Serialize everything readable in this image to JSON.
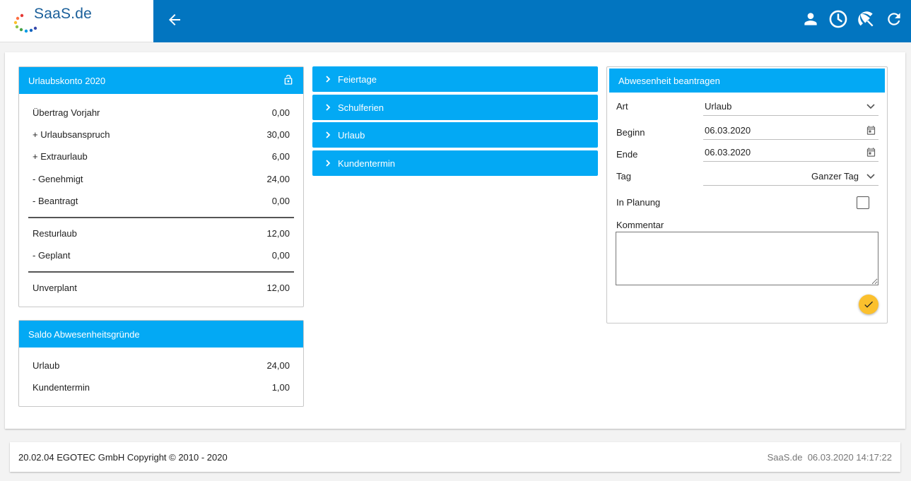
{
  "header": {
    "logo_text": "SaaS.de",
    "icons": [
      "back-arrow-icon",
      "user-icon",
      "clock-icon",
      "beach-umbrella-icon",
      "refresh-icon"
    ],
    "brand_color": "#0275c0"
  },
  "urlaubskonto": {
    "title": "Urlaubskonto 2020",
    "rows": [
      {
        "label": "Übertrag Vorjahr",
        "value": "0,00"
      },
      {
        "label": "+ Urlaubsanspruch",
        "value": "30,00"
      },
      {
        "label": "+ Extraurlaub",
        "value": "6,00"
      },
      {
        "label": "- Genehmigt",
        "value": "24,00"
      },
      {
        "label": "- Beantragt",
        "value": "0,00"
      },
      {
        "label": "Resturlaub",
        "value": "12,00"
      },
      {
        "label": "- Geplant",
        "value": "0,00"
      },
      {
        "label": "Unverplant",
        "value": "12,00"
      }
    ]
  },
  "saldo": {
    "title": "Saldo Abwesenheitsgründe",
    "rows": [
      {
        "label": "Urlaub",
        "value": "24,00"
      },
      {
        "label": "Kundentermin",
        "value": "1,00"
      }
    ]
  },
  "accordion": {
    "items": [
      "Feiertage",
      "Schulferien",
      "Urlaub",
      "Kundentermin"
    ]
  },
  "form": {
    "title": "Abwesenheit beantragen",
    "art_label": "Art",
    "art_value": "Urlaub",
    "beginn_label": "Beginn",
    "beginn_value": "06.03.2020",
    "ende_label": "Ende",
    "ende_value": "06.03.2020",
    "tag_label": "Tag",
    "tag_value": "Ganzer Tag",
    "planung_label": "In Planung",
    "planung_checked": false,
    "kommentar_label": "Kommentar",
    "kommentar_value": ""
  },
  "footer": {
    "left": "20.02.04 EGOTEC GmbH Copyright © 2010 - 2020",
    "right": "SaaS.de  06.03.2020 14:17:22"
  },
  "colors": {
    "panel_header": "#03a9f4",
    "submit": "#fbc02d"
  }
}
